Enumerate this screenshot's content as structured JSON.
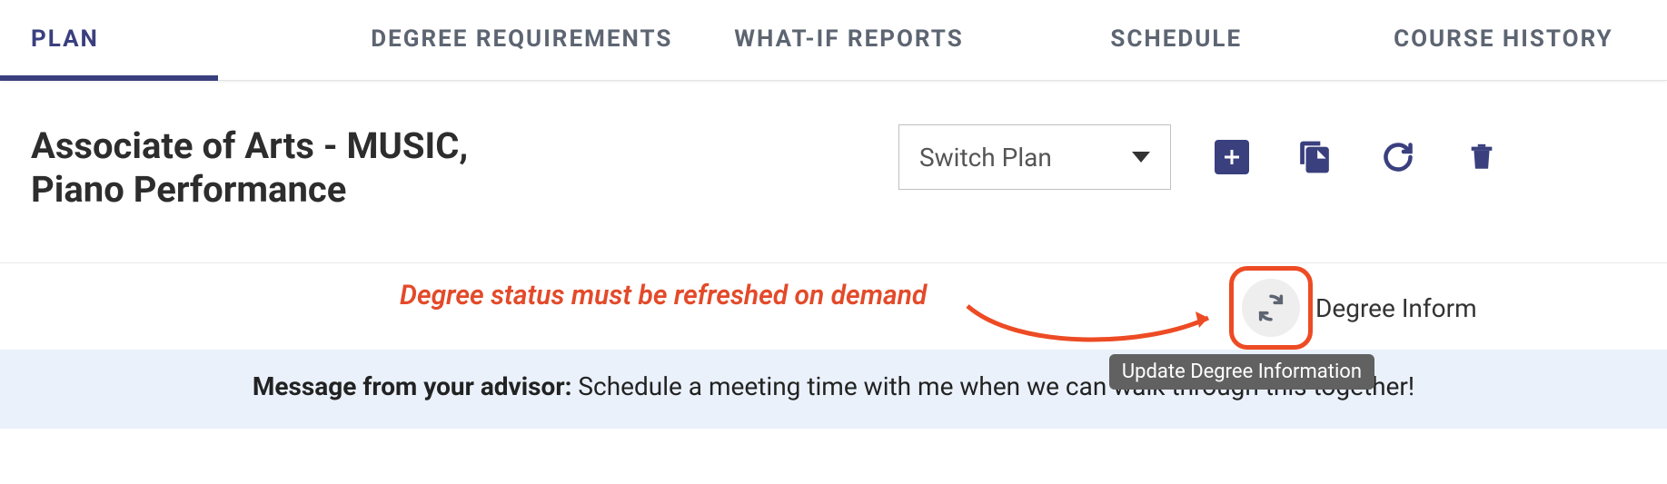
{
  "tabs": {
    "plan": "PLAN",
    "degree_requirements": "DEGREE REQUIREMENTS",
    "what_if": "WHAT-IF REPORTS",
    "schedule": "SCHEDULE",
    "course_history": "COURSE HISTORY"
  },
  "plan_title": "Associate of Arts - MUSIC, Piano Performance",
  "switch_plan": {
    "label": "Switch Plan"
  },
  "annotation_text": "Degree status must be refreshed on demand",
  "degree_info_label": "Degree Inform",
  "tooltip_text": "Update Degree Information",
  "advisor": {
    "label": "Message from your advisor:",
    "text": " Schedule a meeting time with me when we can walk through this together!"
  }
}
